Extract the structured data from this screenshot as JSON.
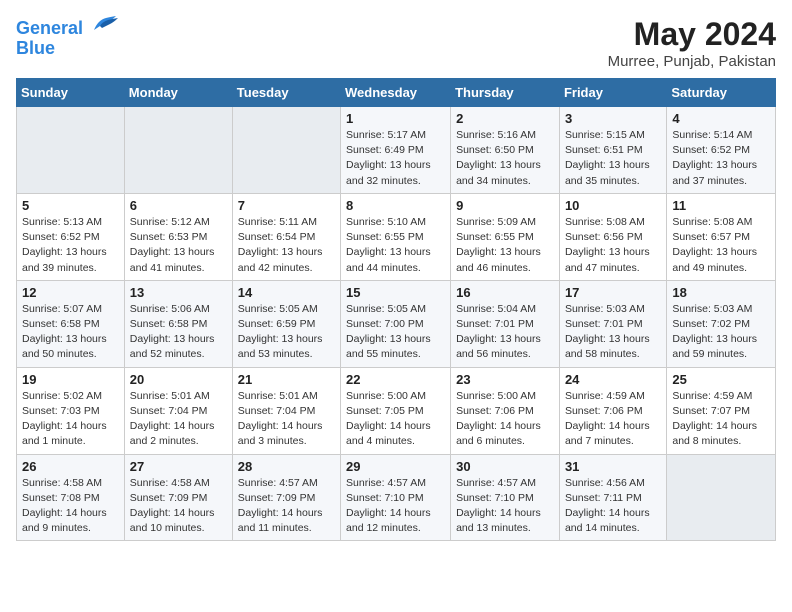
{
  "header": {
    "logo_line1": "General",
    "logo_line2": "Blue",
    "month": "May 2024",
    "location": "Murree, Punjab, Pakistan"
  },
  "days_of_week": [
    "Sunday",
    "Monday",
    "Tuesday",
    "Wednesday",
    "Thursday",
    "Friday",
    "Saturday"
  ],
  "weeks": [
    [
      {
        "day": "",
        "empty": true
      },
      {
        "day": "",
        "empty": true
      },
      {
        "day": "",
        "empty": true
      },
      {
        "day": "1",
        "sunrise": "5:17 AM",
        "sunset": "6:49 PM",
        "daylight": "13 hours and 32 minutes."
      },
      {
        "day": "2",
        "sunrise": "5:16 AM",
        "sunset": "6:50 PM",
        "daylight": "13 hours and 34 minutes."
      },
      {
        "day": "3",
        "sunrise": "5:15 AM",
        "sunset": "6:51 PM",
        "daylight": "13 hours and 35 minutes."
      },
      {
        "day": "4",
        "sunrise": "5:14 AM",
        "sunset": "6:52 PM",
        "daylight": "13 hours and 37 minutes."
      }
    ],
    [
      {
        "day": "5",
        "sunrise": "5:13 AM",
        "sunset": "6:52 PM",
        "daylight": "13 hours and 39 minutes."
      },
      {
        "day": "6",
        "sunrise": "5:12 AM",
        "sunset": "6:53 PM",
        "daylight": "13 hours and 41 minutes."
      },
      {
        "day": "7",
        "sunrise": "5:11 AM",
        "sunset": "6:54 PM",
        "daylight": "13 hours and 42 minutes."
      },
      {
        "day": "8",
        "sunrise": "5:10 AM",
        "sunset": "6:55 PM",
        "daylight": "13 hours and 44 minutes."
      },
      {
        "day": "9",
        "sunrise": "5:09 AM",
        "sunset": "6:55 PM",
        "daylight": "13 hours and 46 minutes."
      },
      {
        "day": "10",
        "sunrise": "5:08 AM",
        "sunset": "6:56 PM",
        "daylight": "13 hours and 47 minutes."
      },
      {
        "day": "11",
        "sunrise": "5:08 AM",
        "sunset": "6:57 PM",
        "daylight": "13 hours and 49 minutes."
      }
    ],
    [
      {
        "day": "12",
        "sunrise": "5:07 AM",
        "sunset": "6:58 PM",
        "daylight": "13 hours and 50 minutes."
      },
      {
        "day": "13",
        "sunrise": "5:06 AM",
        "sunset": "6:58 PM",
        "daylight": "13 hours and 52 minutes."
      },
      {
        "day": "14",
        "sunrise": "5:05 AM",
        "sunset": "6:59 PM",
        "daylight": "13 hours and 53 minutes."
      },
      {
        "day": "15",
        "sunrise": "5:05 AM",
        "sunset": "7:00 PM",
        "daylight": "13 hours and 55 minutes."
      },
      {
        "day": "16",
        "sunrise": "5:04 AM",
        "sunset": "7:01 PM",
        "daylight": "13 hours and 56 minutes."
      },
      {
        "day": "17",
        "sunrise": "5:03 AM",
        "sunset": "7:01 PM",
        "daylight": "13 hours and 58 minutes."
      },
      {
        "day": "18",
        "sunrise": "5:03 AM",
        "sunset": "7:02 PM",
        "daylight": "13 hours and 59 minutes."
      }
    ],
    [
      {
        "day": "19",
        "sunrise": "5:02 AM",
        "sunset": "7:03 PM",
        "daylight": "14 hours and 1 minute."
      },
      {
        "day": "20",
        "sunrise": "5:01 AM",
        "sunset": "7:04 PM",
        "daylight": "14 hours and 2 minutes."
      },
      {
        "day": "21",
        "sunrise": "5:01 AM",
        "sunset": "7:04 PM",
        "daylight": "14 hours and 3 minutes."
      },
      {
        "day": "22",
        "sunrise": "5:00 AM",
        "sunset": "7:05 PM",
        "daylight": "14 hours and 4 minutes."
      },
      {
        "day": "23",
        "sunrise": "5:00 AM",
        "sunset": "7:06 PM",
        "daylight": "14 hours and 6 minutes."
      },
      {
        "day": "24",
        "sunrise": "4:59 AM",
        "sunset": "7:06 PM",
        "daylight": "14 hours and 7 minutes."
      },
      {
        "day": "25",
        "sunrise": "4:59 AM",
        "sunset": "7:07 PM",
        "daylight": "14 hours and 8 minutes."
      }
    ],
    [
      {
        "day": "26",
        "sunrise": "4:58 AM",
        "sunset": "7:08 PM",
        "daylight": "14 hours and 9 minutes."
      },
      {
        "day": "27",
        "sunrise": "4:58 AM",
        "sunset": "7:09 PM",
        "daylight": "14 hours and 10 minutes."
      },
      {
        "day": "28",
        "sunrise": "4:57 AM",
        "sunset": "7:09 PM",
        "daylight": "14 hours and 11 minutes."
      },
      {
        "day": "29",
        "sunrise": "4:57 AM",
        "sunset": "7:10 PM",
        "daylight": "14 hours and 12 minutes."
      },
      {
        "day": "30",
        "sunrise": "4:57 AM",
        "sunset": "7:10 PM",
        "daylight": "14 hours and 13 minutes."
      },
      {
        "day": "31",
        "sunrise": "4:56 AM",
        "sunset": "7:11 PM",
        "daylight": "14 hours and 14 minutes."
      },
      {
        "day": "",
        "empty": true
      }
    ]
  ],
  "labels": {
    "sunrise_prefix": "Sunrise: ",
    "sunset_prefix": "Sunset: ",
    "daylight_prefix": "Daylight: "
  }
}
